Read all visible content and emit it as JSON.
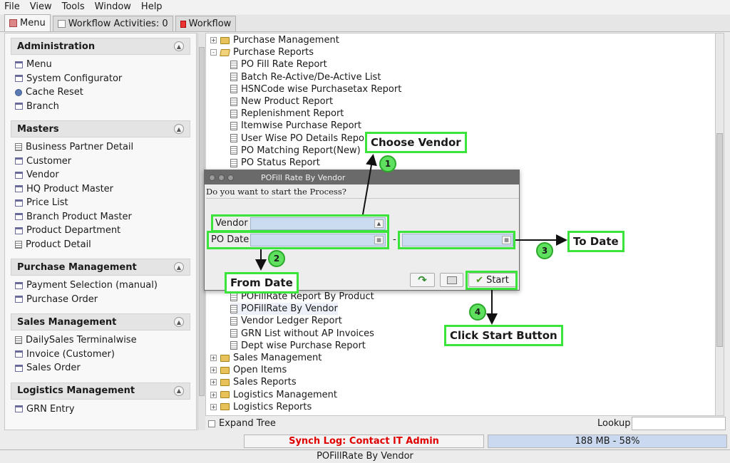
{
  "menubar": [
    "File",
    "View",
    "Tools",
    "Window",
    "Help"
  ],
  "tabs": [
    {
      "label": "Menu",
      "icon": "home-icon"
    },
    {
      "label": "Workflow Activities: 0",
      "icon": "document-icon"
    },
    {
      "label": "Workflow",
      "icon": "workflow-icon"
    }
  ],
  "sidebar": {
    "sections": [
      {
        "title": "Administration",
        "items": [
          {
            "label": "Menu",
            "icon": "window-icon"
          },
          {
            "label": "System Configurator",
            "icon": "window-icon"
          },
          {
            "label": "Cache Reset",
            "icon": "gear-icon"
          },
          {
            "label": "Branch",
            "icon": "window-icon"
          }
        ]
      },
      {
        "title": "Masters",
        "items": [
          {
            "label": "Business Partner Detail",
            "icon": "form-icon"
          },
          {
            "label": "Customer",
            "icon": "window-icon"
          },
          {
            "label": "Vendor",
            "icon": "window-icon"
          },
          {
            "label": "HQ Product Master",
            "icon": "window-icon"
          },
          {
            "label": "Price List",
            "icon": "window-icon"
          },
          {
            "label": "Branch Product Master",
            "icon": "window-icon"
          },
          {
            "label": "Product Department",
            "icon": "window-icon"
          },
          {
            "label": "Product Detail",
            "icon": "form-icon"
          }
        ]
      },
      {
        "title": "Purchase Management",
        "items": [
          {
            "label": "Payment Selection (manual)",
            "icon": "window-icon"
          },
          {
            "label": "Purchase Order",
            "icon": "window-icon"
          }
        ]
      },
      {
        "title": "Sales Management",
        "items": [
          {
            "label": "DailySales Terminalwise",
            "icon": "form-icon"
          },
          {
            "label": "Invoice (Customer)",
            "icon": "window-icon"
          },
          {
            "label": "Sales Order",
            "icon": "window-icon"
          }
        ]
      },
      {
        "title": "Logistics Management",
        "items": [
          {
            "label": "GRN Entry",
            "icon": "window-icon"
          }
        ]
      }
    ]
  },
  "tree": {
    "top": [
      {
        "label": "Purchase Management",
        "expanded": false
      },
      {
        "label": "Purchase Reports",
        "expanded": true
      }
    ],
    "reports": [
      "PO Fill Rate Report",
      "Batch Re-Active/De-Active List",
      "HSNCode wise Purchasetax Report",
      "New Product Report",
      "Replenishment Report",
      "Itemwise Purchase Report",
      "User Wise PO Details Report",
      "PO Matching Report(New)",
      "PO Status Report"
    ],
    "reports_after": [
      "POFillRate Report By Product",
      "POFillRate By Vendor",
      "Vendor Ledger Report",
      "GRN List without AP Invoices",
      "Dept wise Purchase Report"
    ],
    "bottom": [
      "Sales Management",
      "Open Items",
      "Sales Reports",
      "Logistics Management",
      "Logistics Reports"
    ]
  },
  "footer": {
    "expand_tree": "Expand Tree",
    "lookup": "Lookup",
    "synch_log": "Synch Log: Contact IT Admin",
    "memory": "188 MB - 58%",
    "status": "POFillRate By Vendor"
  },
  "dialog": {
    "title": "POFill Rate By Vendor",
    "question": "Do you want to start the Process?",
    "vendor_label": "Vendor",
    "po_date_label": "PO Date",
    "date_sep": "-",
    "start_label": "Start"
  },
  "annotations": {
    "choose_vendor": "Choose Vendor",
    "from_date": "From Date",
    "to_date": "To Date",
    "click_start": "Click Start Button",
    "step1": "1",
    "step2": "2",
    "step3": "3",
    "step4": "4"
  },
  "colors": {
    "highlight": "#3ae43a",
    "synch_text": "#e00000",
    "field_bg": "#cbdcf0"
  }
}
